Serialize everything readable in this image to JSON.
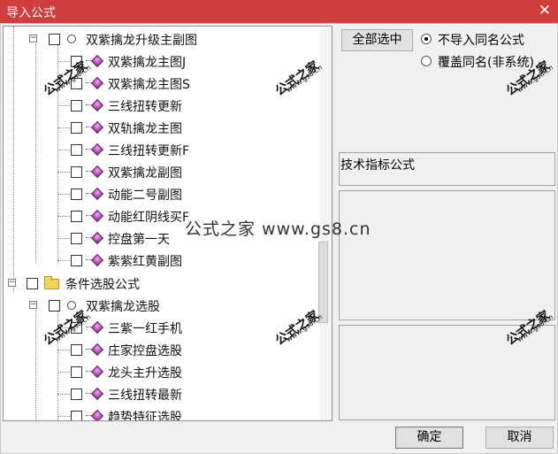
{
  "window": {
    "title": "导入公式",
    "close_glyph": "✕"
  },
  "tree": {
    "group1": {
      "label": "双紫擒龙升级主副图"
    },
    "group1_items": [
      {
        "label": "双紫擒龙主图J"
      },
      {
        "label": "双紫擒龙主图S"
      },
      {
        "label": "三线扭转更新"
      },
      {
        "label": "双轨擒龙主图"
      },
      {
        "label": "三线扭转更新F"
      },
      {
        "label": "双紫擒龙副图"
      },
      {
        "label": "动能二号副图"
      },
      {
        "label": "动能红阴线买F"
      },
      {
        "label": "控盘第一天"
      },
      {
        "label": "紫紫红黄副图"
      }
    ],
    "category2": {
      "label": "条件选股公式"
    },
    "group2": {
      "label": "双紫擒龙选股"
    },
    "group2_items": [
      {
        "label": "三紫一红手机"
      },
      {
        "label": "庄家控盘选股"
      },
      {
        "label": "龙头主升选股"
      },
      {
        "label": "三线扭转最新"
      },
      {
        "label": "趋势特征选股"
      }
    ]
  },
  "side": {
    "select_all_label": "全部选中",
    "radio_skip_label": "不导入同名公式",
    "radio_overwrite_label": "覆盖同名(非系统)",
    "formula_type_label": "技术指标公式"
  },
  "footer": {
    "ok_label": "确定",
    "cancel_label": "取消"
  },
  "watermark": {
    "center_text": "公式之家 www.gs8.cn",
    "stamp_text": "公式之家",
    "url_text": "www.gs8.cn"
  },
  "colors": {
    "titlebar": "#d13c3c",
    "gem": "#8a1e8a",
    "folder": "#f2d45a"
  }
}
